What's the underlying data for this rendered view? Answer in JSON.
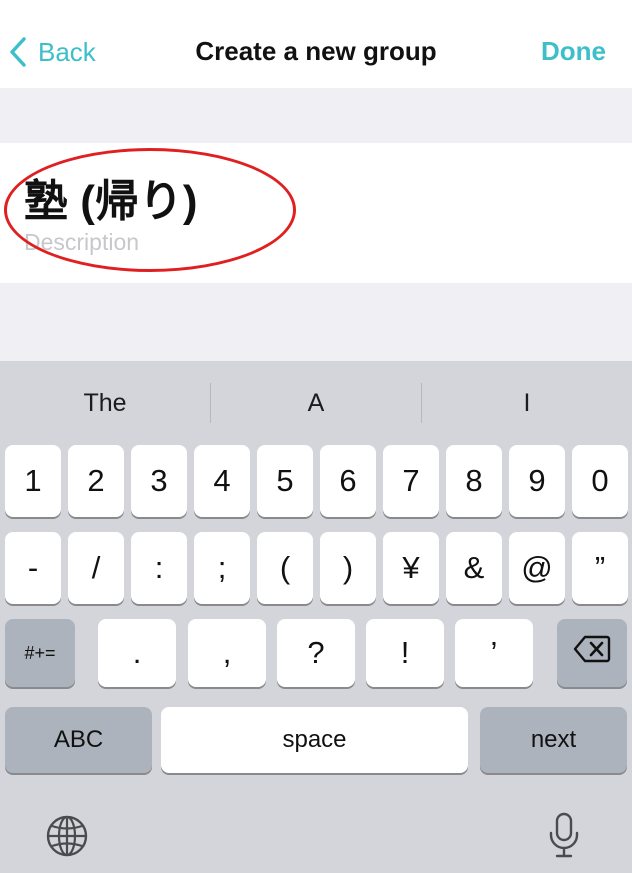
{
  "nav": {
    "back_label": "Back",
    "title": "Create a new group",
    "done_label": "Done"
  },
  "form": {
    "group_name": "塾 (帰り)",
    "description_placeholder": "Description"
  },
  "keyboard": {
    "suggestions": [
      "The",
      "A",
      "I"
    ],
    "row1": [
      "1",
      "2",
      "3",
      "4",
      "5",
      "6",
      "7",
      "8",
      "9",
      "0"
    ],
    "row2": [
      "-",
      "/",
      ":",
      ";",
      "(",
      ")",
      "¥",
      "&",
      "@",
      "”"
    ],
    "row3": {
      "mode_key": "#+=",
      "keys": [
        ".",
        ",",
        "?",
        "!",
        "’"
      ]
    },
    "row4": {
      "abc": "ABC",
      "space": "space",
      "next": "next"
    }
  },
  "colors": {
    "accent": "#3cbfc9",
    "annotation": "#e02020",
    "keyboard_bg": "#d3d5db"
  },
  "icons": {
    "back": "chevron-left-icon",
    "delete": "backspace-icon",
    "globe": "globe-icon",
    "mic": "microphone-icon"
  }
}
